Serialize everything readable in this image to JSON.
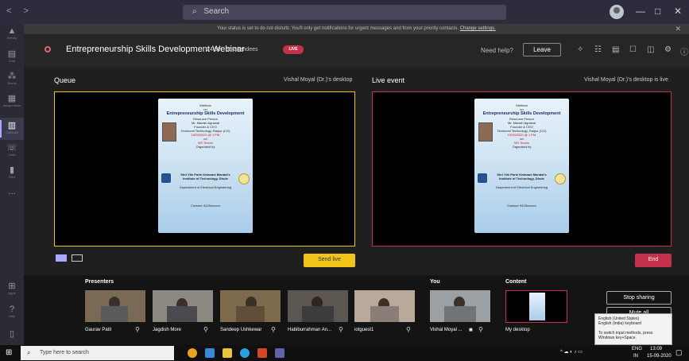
{
  "titlebar": {
    "back": "<",
    "forward": ">",
    "search_label": "Search",
    "minimize": "—",
    "maximize": "□",
    "close": "✕"
  },
  "notice": {
    "text": "Your status is set to do not disturb. You'll only get notifications for urgent messages and from your priority contacts.",
    "link": "Change settings."
  },
  "rail": [
    {
      "label": "Activity",
      "icon": "bell-icon"
    },
    {
      "label": "Chat",
      "icon": "chat-icon"
    },
    {
      "label": "Teams",
      "icon": "teams-icon"
    },
    {
      "label": "Assignments",
      "icon": "assignments-icon"
    },
    {
      "label": "Calendar",
      "icon": "calendar-icon"
    },
    {
      "label": "Calls",
      "icon": "phone-icon"
    },
    {
      "label": "Files",
      "icon": "file-icon"
    },
    {
      "label": "...",
      "icon": "more-icon"
    }
  ],
  "rail_bottom": [
    {
      "label": "Apps"
    },
    {
      "label": "Help"
    }
  ],
  "meeting": {
    "title": "Entrepreneurship Skills Development Webinar",
    "timer": "24:50",
    "attendees": "36 attendees",
    "live_badge": "LIVE",
    "need_help": "Need help?",
    "leave": "Leave"
  },
  "queue": {
    "label": "Queue",
    "source": "Vishal Moyal (Dr.)'s desktop",
    "send_live": "Send live"
  },
  "live_event": {
    "label": "Live event",
    "source": "Vishal Moyal (Dr.)'s desktop is live",
    "end": "End"
  },
  "poster": {
    "l1": "Webinar",
    "l2": "on",
    "title": "Entrepreneurship Skills Development",
    "l3": "Resource Person",
    "l4": "Mr. Manish Agrawal",
    "l5": "Founder & CEO",
    "l6": "Technomi Technology, Raipur (CG)",
    "date": "15/09/2020 @ 1 PM",
    "on": "on",
    "platform": "MS Teams",
    "org": "Organised by",
    "inst1": "Shri Vile Parle Kelavani Mandal's",
    "inst2": "Institute of Technology, Dhule",
    "dept": "Department of Electrical Engineering",
    "contact": "Contact: 9425xxxxxx"
  },
  "presenters": {
    "label": "Presenters",
    "people": [
      {
        "name": "Gaurav Patil"
      },
      {
        "name": "Jagdish More"
      },
      {
        "name": "Sandeep Ushkewar"
      },
      {
        "name": "Habiburrahman An..."
      },
      {
        "name": "iotguest1"
      }
    ]
  },
  "you": {
    "label": "You",
    "name": "Vishal Moyal ..."
  },
  "content": {
    "label": "Content",
    "name": "My desktop"
  },
  "stop_sharing": "Stop sharing",
  "mute_all": "Mute all",
  "ime_tooltip": {
    "l1": "English (United States)",
    "l2": "English (India) keyboard",
    "l3": "To switch input methods, press Windows key+Space."
  },
  "taskbar": {
    "search_placeholder": "Type here to search",
    "lang": "ENG",
    "region": "IN",
    "time": "13:09",
    "date": "15-09-2020"
  }
}
